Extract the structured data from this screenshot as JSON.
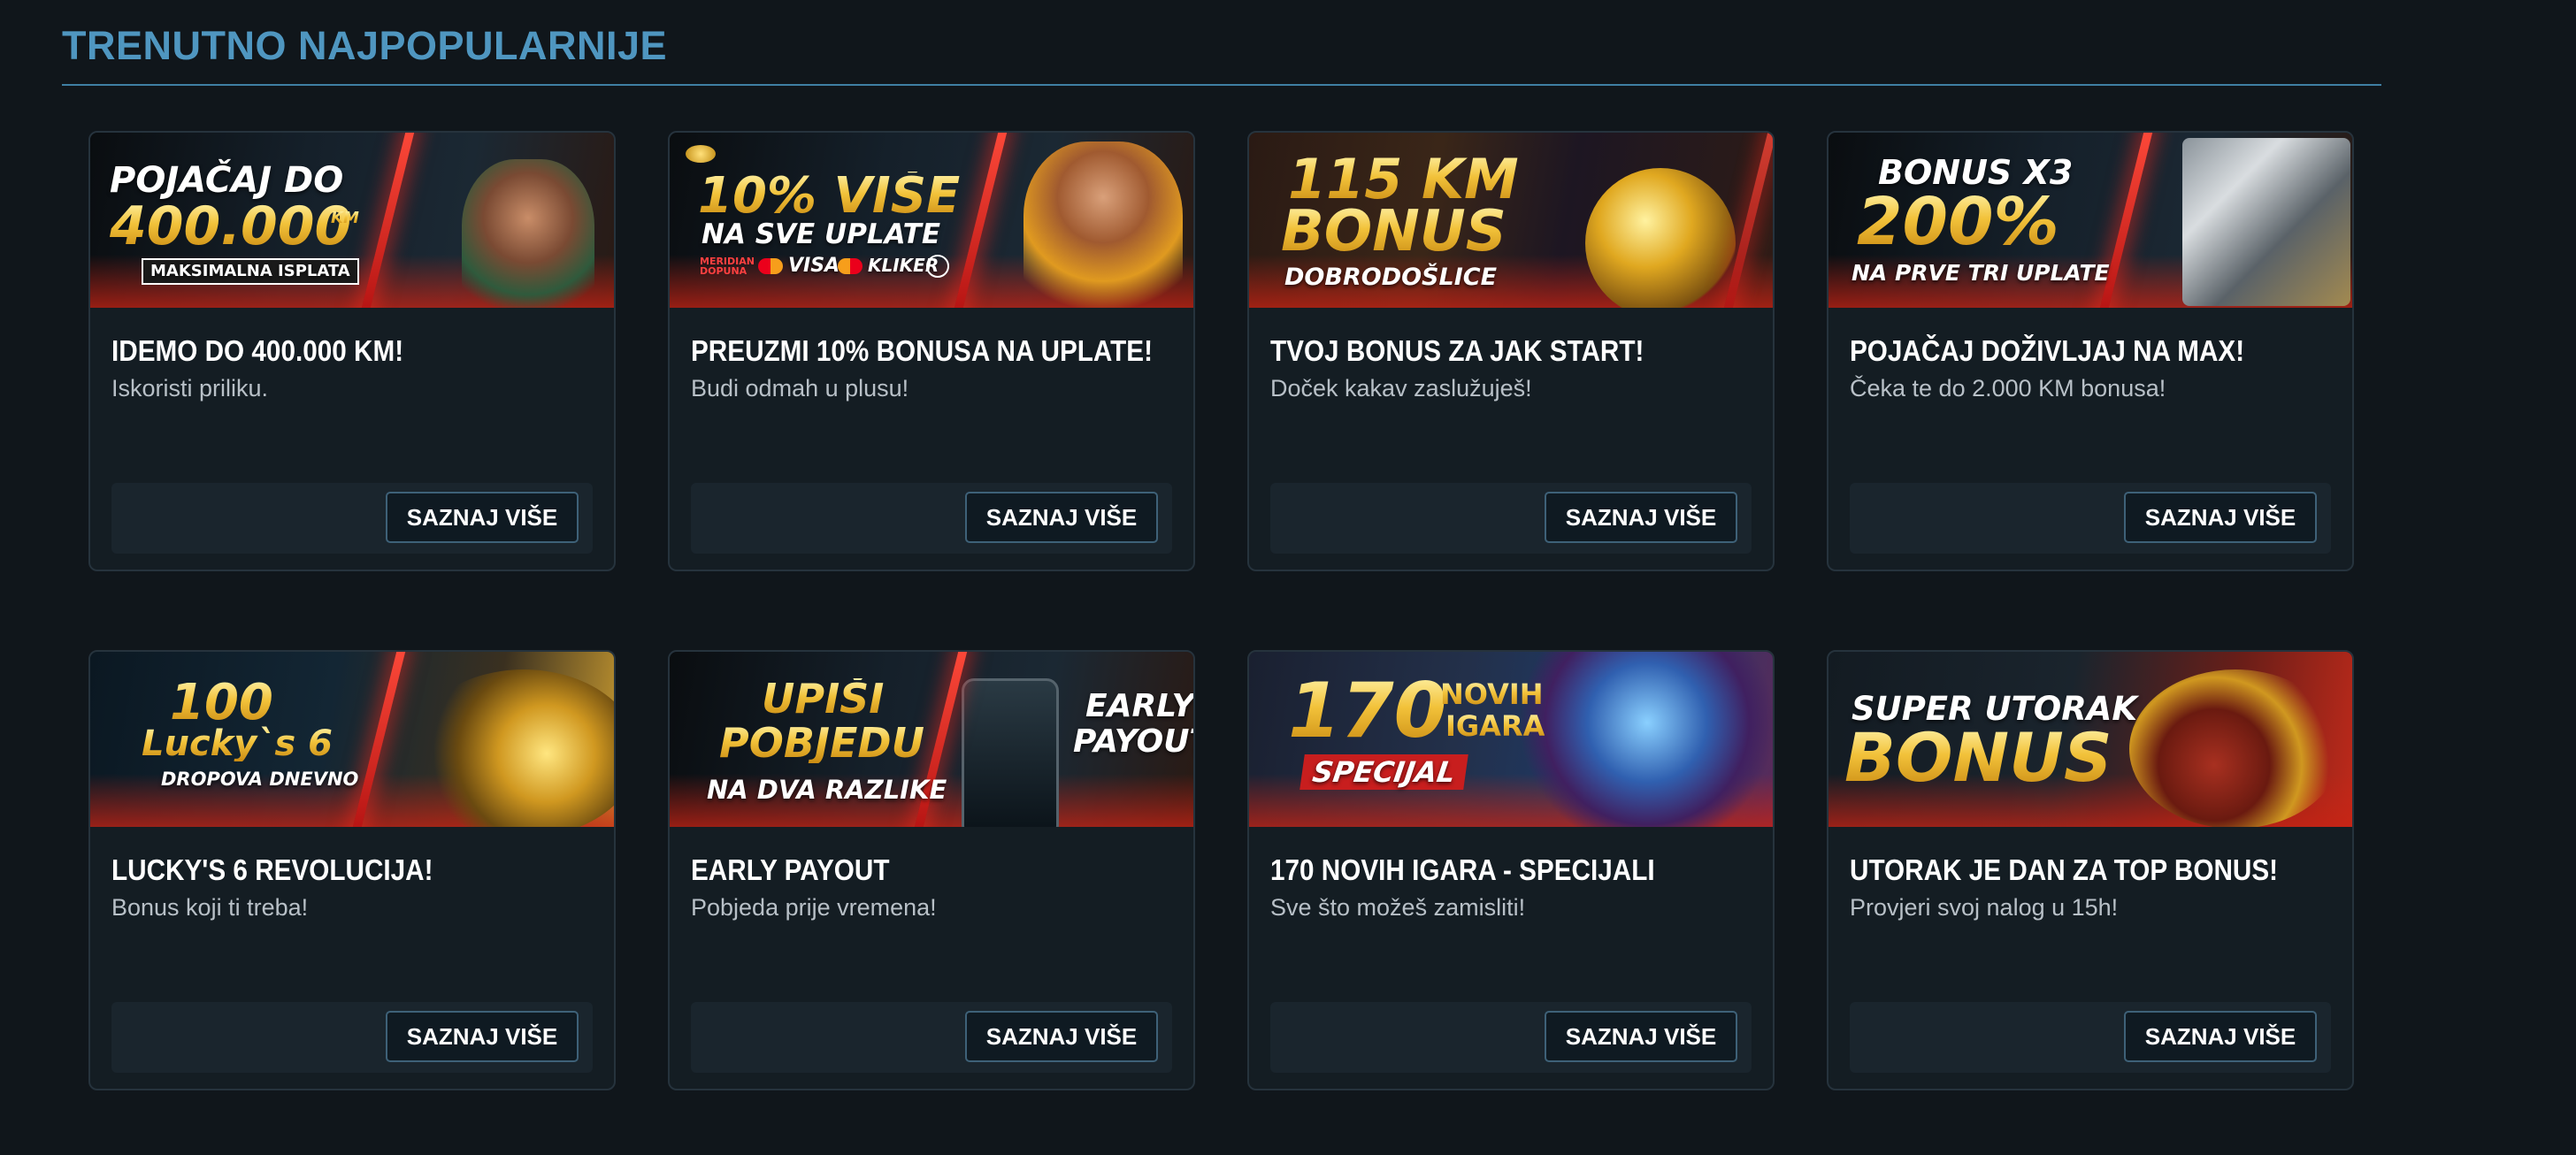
{
  "section": {
    "title": "TRENUTNO NAJPOPULARNIJE"
  },
  "cards": [
    {
      "banner": {
        "lines": [
          "POJAČAJ DO",
          "400.000",
          "KM",
          "MAKSIMALNA ISPLATA"
        ]
      },
      "title": "IDEMO DO 400.000 KM!",
      "subtitle": "Iskoristi priliku.",
      "button": "SAZNAJ VIŠE"
    },
    {
      "banner": {
        "lines": [
          "10% VIŠE",
          "NA SVE UPLATE",
          "meridian DOPUNA",
          "VISA",
          "KLIKER"
        ]
      },
      "title": "PREUZMI 10% BONUSA NA UPLATE!",
      "subtitle": "Budi odmah u plusu!",
      "button": "SAZNAJ VIŠE"
    },
    {
      "banner": {
        "lines": [
          "115 KM",
          "BONUS",
          "DOBRODOŠLICE"
        ]
      },
      "title": "TVOJ BONUS ZA JAK START!",
      "subtitle": "Doček kakav zaslužuješ!",
      "button": "SAZNAJ VIŠE"
    },
    {
      "banner": {
        "lines": [
          "BONUS X3",
          "200%",
          "NA PRVE TRI UPLATE"
        ]
      },
      "title": "POJAČAJ DOŽIVLJAJ NA MAX!",
      "subtitle": "Čeka te do 2.000 KM bonusa!",
      "button": "SAZNAJ VIŠE"
    },
    {
      "banner": {
        "lines": [
          "100",
          "Lucky`s 6",
          "DROPOVA DNEVNO"
        ]
      },
      "title": "LUCKY'S 6 REVOLUCIJA!",
      "subtitle": "Bonus koji ti treba!",
      "button": "SAZNAJ VIŠE"
    },
    {
      "banner": {
        "lines": [
          "UPIŠI",
          "POBJEDU",
          "NA DVA RAZLIKE",
          "EARLY",
          "PAYOUT"
        ]
      },
      "title": "EARLY PAYOUT",
      "subtitle": "Pobjeda prije vremena!",
      "button": "SAZNAJ VIŠE"
    },
    {
      "banner": {
        "lines": [
          "170",
          "NOVIH",
          "IGARA",
          "SPECIJAL"
        ]
      },
      "title": "170 NOVIH IGARA - SPECIJALI",
      "subtitle": "Sve što možeš zamisliti!",
      "button": "SAZNAJ VIŠE"
    },
    {
      "banner": {
        "lines": [
          "SUPER UTORAK",
          "BONUS"
        ]
      },
      "title": "UTORAK JE DAN ZA TOP BONUS!",
      "subtitle": "Provjeri svoj nalog u 15h!",
      "button": "SAZNAJ VIŠE"
    }
  ]
}
